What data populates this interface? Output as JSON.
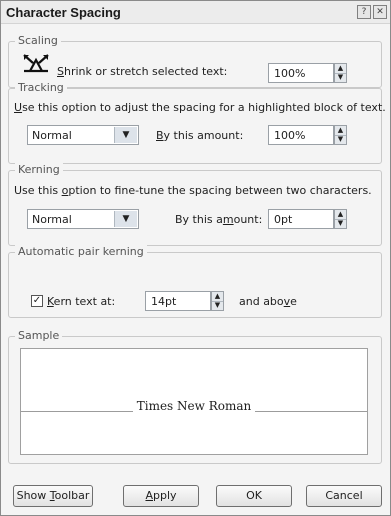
{
  "window": {
    "title": "Character Spacing",
    "help_glyph": "?",
    "close_glyph": "✕"
  },
  "scaling": {
    "legend": "Scaling",
    "icon": "shrink-stretch-icon",
    "label_pre": "",
    "label_key": "S",
    "label_post": "hrink or stretch selected text:",
    "value": "100%"
  },
  "tracking": {
    "legend": "Tracking",
    "desc_key": "U",
    "desc_post": "se this option to adjust the spacing for a highlighted block of text.",
    "mode": "Normal",
    "amount_key": "B",
    "amount_post": "y this amount:",
    "amount": "100%"
  },
  "kerning": {
    "legend": "Kerning",
    "desc_pre": "Use this ",
    "desc_key": "o",
    "desc_post": "ption to fine-tune the spacing between two characters.",
    "mode": "Normal",
    "amount_pre": "By this a",
    "amount_key": "m",
    "amount_post": "ount:",
    "amount": "0pt"
  },
  "auto_kerning": {
    "legend": "Automatic pair kerning",
    "checked": true,
    "label_key": "K",
    "label_post": "ern text at:",
    "value": "14pt",
    "suffix_pre": "and abo",
    "suffix_key": "v",
    "suffix_post": "e"
  },
  "sample": {
    "legend": "Sample",
    "text": "Times New Roman"
  },
  "buttons": {
    "show_toolbar_pre": "Show ",
    "show_toolbar_key": "T",
    "show_toolbar_post": "oolbar",
    "apply_key": "A",
    "apply_post": "pply",
    "ok": "OK",
    "cancel": "Cancel"
  },
  "colors": {
    "dialog_bg": "#f4f4f4",
    "title_text": "#1b1b1b"
  }
}
